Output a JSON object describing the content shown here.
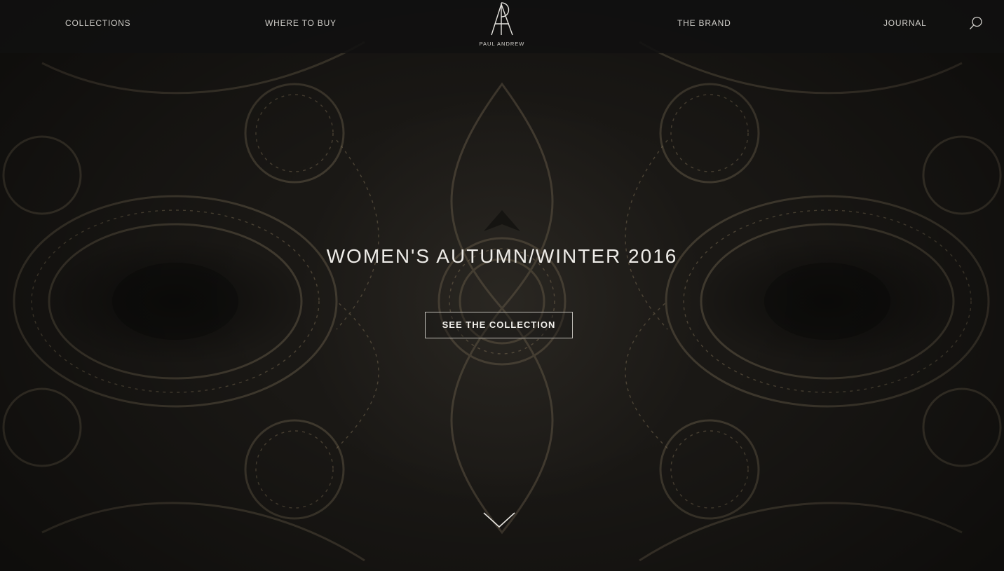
{
  "nav": {
    "left_items": [
      {
        "label": "COLLECTIONS"
      },
      {
        "label": "WHERE TO BUY"
      }
    ],
    "right_items": [
      {
        "label": "THE BRAND"
      },
      {
        "label": "JOURNAL"
      }
    ],
    "search_icon": "search-icon"
  },
  "logo": {
    "monogram": "PA",
    "text": "PAUL ANDREW"
  },
  "hero": {
    "title": "WOMEN'S AUTUMN/WINTER 2016",
    "cta_label": "SEE THE COLLECTION",
    "scroll_icon": "chevron-down-icon"
  },
  "colors": {
    "nav_background": "#101010",
    "nav_text": "#cfcdc8",
    "hero_text": "#eeece8",
    "pattern_gold": "#8a7a5c"
  }
}
